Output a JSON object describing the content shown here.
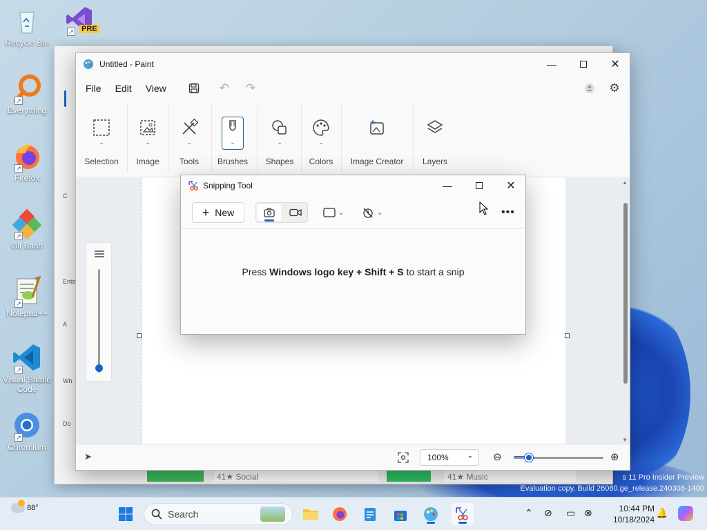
{
  "desktop": {
    "icons": [
      {
        "label": "Recycle Bin"
      },
      {
        "label": "Everything"
      },
      {
        "label": "Firefox"
      },
      {
        "label": "Git Bash"
      },
      {
        "label": "Notepad++"
      },
      {
        "label": "Visual Studio Code"
      },
      {
        "label": "Chromium"
      }
    ],
    "vs_badge": "PRE",
    "watermark_line1": "s 11 Pro Insider Preview",
    "watermark_line2": "Evaluation copy. Build 26080.ge_release.240308-1400"
  },
  "background_window": {
    "labels": [
      "C",
      "Ente",
      "A",
      "Wh",
      "Do"
    ]
  },
  "paint": {
    "title": "Untitled - Paint",
    "menu": [
      "File",
      "Edit",
      "View"
    ],
    "ribbon": {
      "selection": "Selection",
      "image": "Image",
      "tools": "Tools",
      "brushes": "Brushes",
      "shapes": "Shapes",
      "colors": "Colors",
      "image_creator": "Image Creator",
      "layers": "Layers"
    },
    "zoom_level": "100%",
    "zoom_slider_fraction": 0.16
  },
  "behind_tiles": {
    "tile1": "41★ Social",
    "tile2": "41★ Music"
  },
  "snipping_tool": {
    "title": "Snipping Tool",
    "new_label": "New",
    "hint_prefix": "Press ",
    "hint_keys_1": "Windows logo key",
    "hint_plus_1": " + ",
    "hint_keys_2": "Shift",
    "hint_plus_2": " + ",
    "hint_keys_3": "S",
    "hint_suffix": " to start a snip"
  },
  "taskbar": {
    "weather_temp": "88°",
    "search_placeholder": "Search",
    "time": "10:44 PM",
    "date": "10/18/2024"
  },
  "colors": {
    "accent": "#1363c2",
    "taskbar_bg": "#e4edf5"
  }
}
